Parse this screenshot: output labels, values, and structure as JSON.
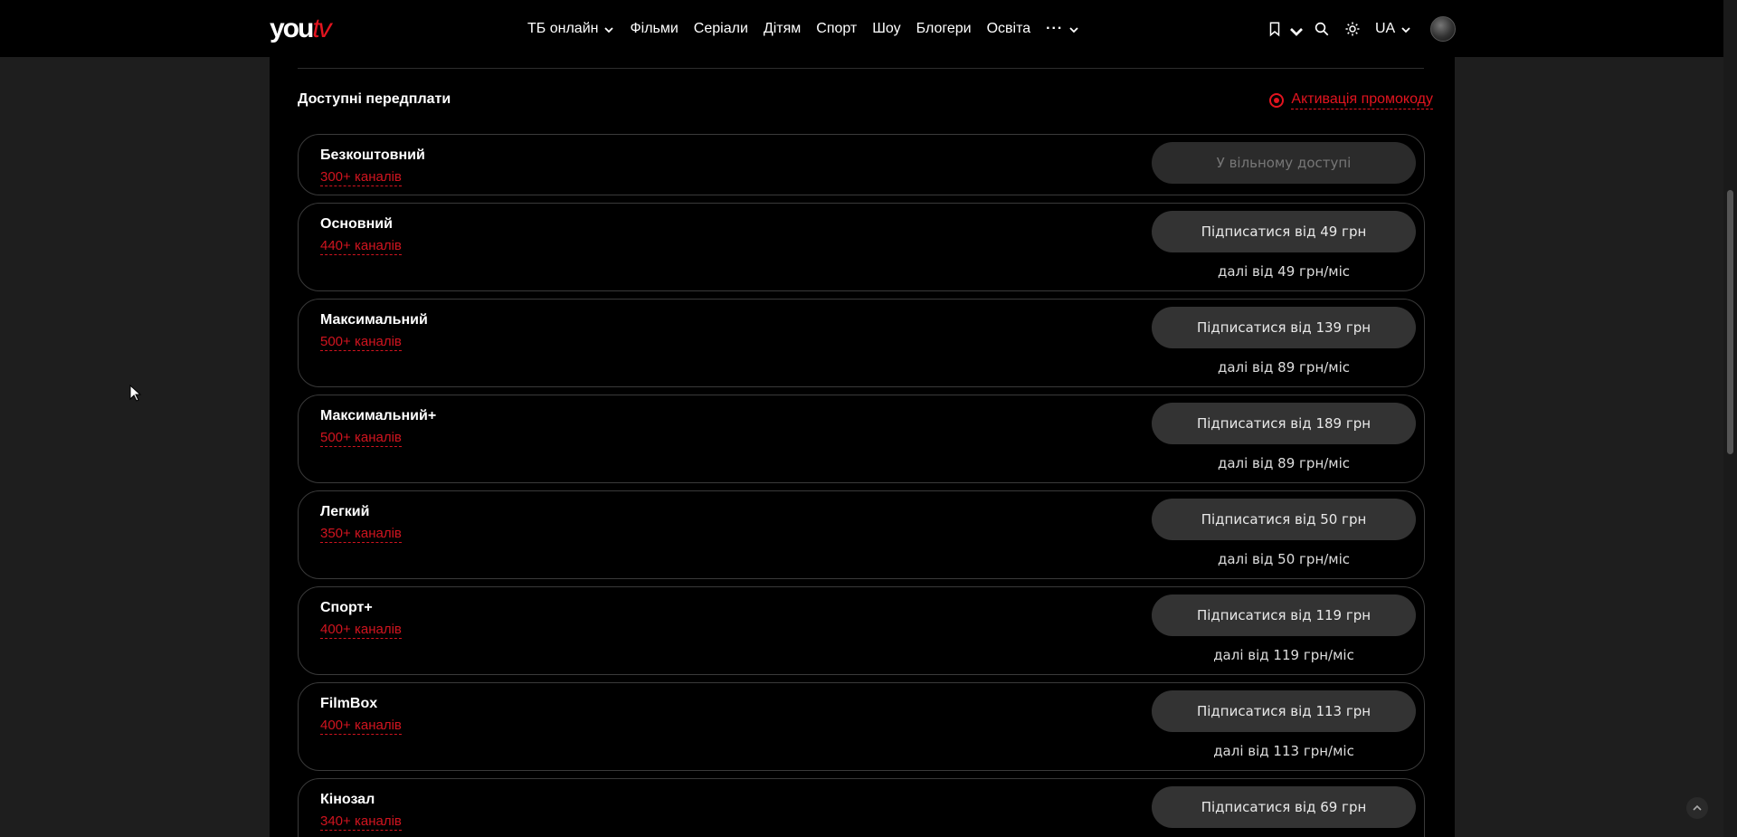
{
  "header": {
    "logo_you": "you",
    "logo_tv": "tv",
    "nav": [
      {
        "label": "ТБ онлайн",
        "dropdown": true
      },
      {
        "label": "Фільми",
        "dropdown": false
      },
      {
        "label": "Серіали",
        "dropdown": false
      },
      {
        "label": "Дітям",
        "dropdown": false
      },
      {
        "label": "Спорт",
        "dropdown": false
      },
      {
        "label": "Шоу",
        "dropdown": false
      },
      {
        "label": "Блогери",
        "dropdown": false
      },
      {
        "label": "Освіта",
        "dropdown": false
      }
    ],
    "more_label": "···",
    "language": "UA",
    "icons": [
      "bookmark-icon",
      "search-icon",
      "sun-icon",
      "avatar"
    ]
  },
  "section": {
    "title": "Доступні передплати",
    "promo_label": "Активація промокоду"
  },
  "plans": [
    {
      "name": "Безкоштовний",
      "channels": "300+ каналів",
      "button": "У вільному доступі",
      "note": "",
      "free": true
    },
    {
      "name": "Основний",
      "channels": "440+ каналів",
      "button": "Підписатися від 49 грн",
      "note": "далі від 49 грн/міс",
      "free": false
    },
    {
      "name": "Максимальний",
      "channels": "500+ каналів",
      "button": "Підписатися від 139 грн",
      "note": "далі від 89 грн/міс",
      "free": false
    },
    {
      "name": "Максимальний+",
      "channels": "500+ каналів",
      "button": "Підписатися від 189 грн",
      "note": "далі від 89 грн/міс",
      "free": false
    },
    {
      "name": "Легкий",
      "channels": "350+ каналів",
      "button": "Підписатися від 50 грн",
      "note": "далі від 50 грн/міс",
      "free": false
    },
    {
      "name": "Спорт+",
      "channels": "400+ каналів",
      "button": "Підписатися від 119 грн",
      "note": "далі від 119 грн/міс",
      "free": false
    },
    {
      "name": "FilmBox",
      "channels": "400+ каналів",
      "button": "Підписатися від 113 грн",
      "note": "далі від 113 грн/міс",
      "free": false
    },
    {
      "name": "Кінозал",
      "channels": "340+ каналів",
      "button": "Підписатися від 69 грн",
      "note": "",
      "free": false
    }
  ],
  "colors": {
    "accent": "#e3141f",
    "background": "#000000",
    "page_bg": "#1e1e1e",
    "button_bg": "#333333"
  }
}
